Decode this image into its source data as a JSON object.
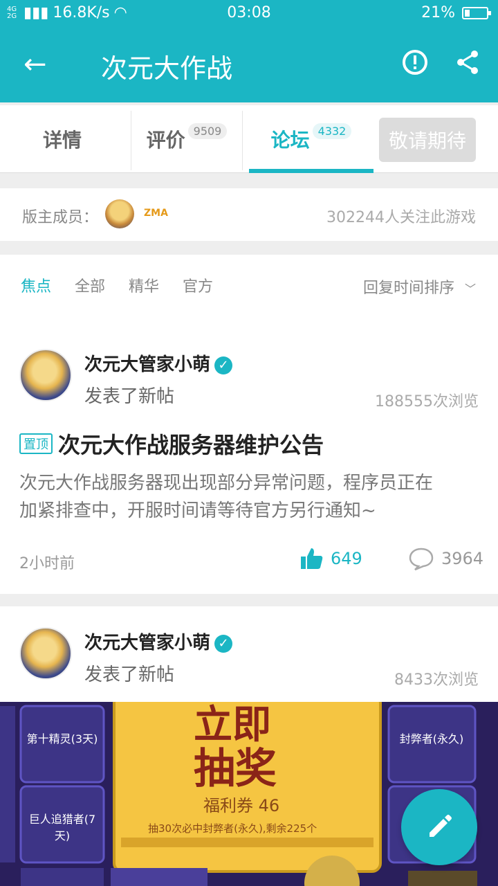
{
  "status": {
    "network": "4G 2G",
    "speed": "16.8K/s",
    "time": "03:08",
    "battery": "21%"
  },
  "appbar": {
    "title": "次元大作战"
  },
  "tabs": [
    {
      "label": "详情"
    },
    {
      "label": "评价",
      "count": "9509"
    },
    {
      "label": "论坛",
      "count": "4332"
    }
  ],
  "wait_button": "敬请期待",
  "moderators": {
    "label": "版主成员：",
    "logo_text": "ZMA",
    "follow_text": "302244人关注此游戏"
  },
  "filter": {
    "tabs": [
      "焦点",
      "全部",
      "精华",
      "官方"
    ],
    "sort": "回复时间排序"
  },
  "posts": [
    {
      "user": "次元大管家小萌",
      "action": "发表了新帖",
      "views": "188555次浏览",
      "pin": "置顶",
      "title": "次元大作战服务器维护公告",
      "body_line1": "次元大作战服务器现出现部分异常问题，程序员正在",
      "body_line2": "加紧排查中，开服时间请等待官方另行通知~",
      "time": "2小时前",
      "likes": "649",
      "comments": "3964"
    },
    {
      "user": "次元大管家小萌",
      "action": "发表了新帖",
      "views": "8433次浏览"
    }
  ],
  "banner": {
    "headline1": "立即",
    "headline2": "抽奖",
    "coupon": "福利券 46",
    "note": "抽30次必中封弊者(永久),剩余225个",
    "left_items": [
      "第十精灵(3天)",
      "巨人追猎者(7天)"
    ],
    "right_items": [
      "封弊者(永久)"
    ]
  },
  "colors": {
    "accent": "#1bb6c4",
    "banner_bg": "#2a1f5c",
    "banner_gold": "#f5c542"
  }
}
